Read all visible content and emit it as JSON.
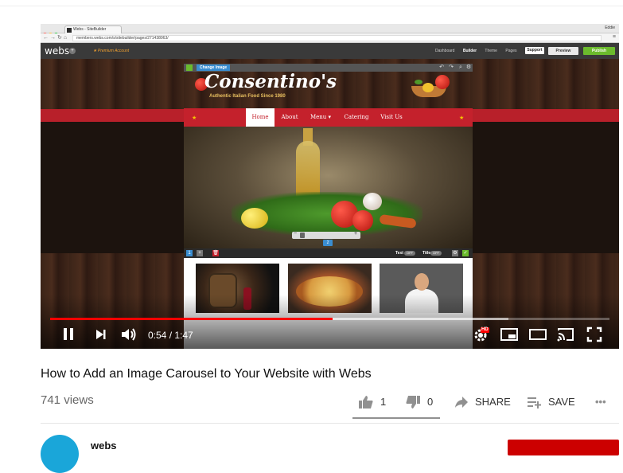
{
  "browser": {
    "tab_title": "Webs - SiteBuilder",
    "user": "Eddie",
    "url": "members.webs.com/s/sitebuilder/pages/271438063/"
  },
  "builder": {
    "logo": "webs",
    "premium_label": "Premium Account",
    "nav": [
      "Dashboard",
      "Builder",
      "Theme",
      "Pages"
    ],
    "support_label": "Support",
    "preview_label": "Preview",
    "publish_label": "Publish",
    "change_image_label": "Change Image",
    "text_toggle_label": "Text",
    "title_toggle_label": "Title",
    "toggle_state": "OFF",
    "slide_indicator": "2"
  },
  "site": {
    "title": "Consentino's",
    "subtitle": "Authentic Italian Food Since 1980",
    "menu": [
      {
        "label": "Home",
        "active": true
      },
      {
        "label": "About",
        "active": false
      },
      {
        "label": "Menu ▾",
        "active": false
      },
      {
        "label": "Catering",
        "active": false
      },
      {
        "label": "Visit Us",
        "active": false
      }
    ]
  },
  "player": {
    "current_time": "0:54",
    "duration": "1:47",
    "time_display": "0:54 / 1:47",
    "played_fraction": 0.505,
    "buffered_fraction": 0.82,
    "hd_badge": "HD"
  },
  "video": {
    "title": "How to Add an Image Carousel to Your Website with Webs",
    "views": "741 views",
    "likes": "1",
    "dislikes": "0",
    "share_label": "SHARE",
    "save_label": "SAVE",
    "more_label": "•••"
  },
  "colors": {
    "progress": "#ff0000",
    "publish": "#6bbb2d",
    "site_red": "#c4212c",
    "accent_blue": "#3a8dd0"
  }
}
